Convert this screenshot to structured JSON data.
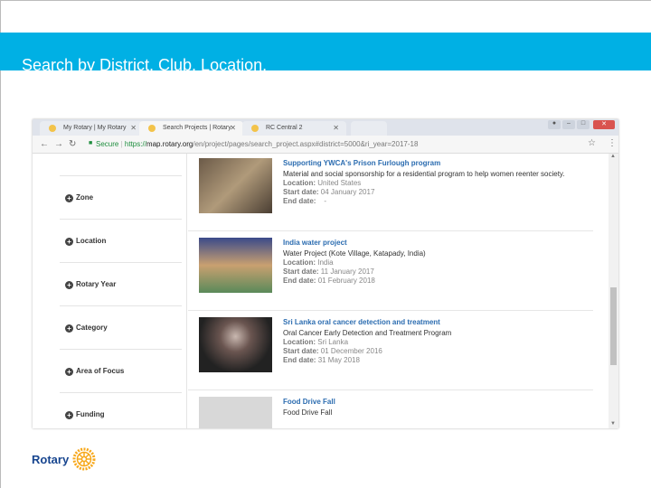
{
  "slide": {
    "title": "Search by District, Club, Location."
  },
  "browser": {
    "tabs": [
      {
        "label": "My Rotary | My Rotary",
        "active": false
      },
      {
        "label": "Search Projects | Rotary",
        "active": true
      },
      {
        "label": "RC Central 2",
        "active": false
      }
    ],
    "address": {
      "secure_label": "Secure",
      "scheme": "https://",
      "host": "map.rotary.org",
      "path": "/en/project/pages/search_project.aspx#district=5000&ri_year=2017-18"
    },
    "filters": [
      "Zone",
      "Location",
      "Rotary Year",
      "Category",
      "Area of Focus",
      "Funding"
    ],
    "projects": [
      {
        "title": "Supporting YWCA's Prison Furlough program",
        "description": "Material and social sponsorship for a residential program to help women reenter society.",
        "location": "United States",
        "start": "04 January 2017",
        "end": "-"
      },
      {
        "title": "India water project",
        "description": "Water Project (Kote Village, Katapady, India)",
        "location": "India",
        "start": "11 January 2017",
        "end": "01 February 2018"
      },
      {
        "title": "Sri Lanka oral cancer detection and treatment",
        "description": "Oral Cancer Early Detection and Treatment Program",
        "location": "Sri Lanka",
        "start": "01 December 2016",
        "end": "31 May 2018"
      },
      {
        "title": "Food Drive Fall",
        "description": "Food Drive Fall"
      }
    ],
    "labels": {
      "location": "Location:",
      "start": "Start date:",
      "end": "End date:"
    }
  },
  "logo": {
    "text": "Rotary"
  },
  "colors": {
    "banner": "#00b0e4",
    "link": "#2b6cb0",
    "rotary_blue": "#17458f",
    "rotary_gold": "#f7a81b"
  }
}
